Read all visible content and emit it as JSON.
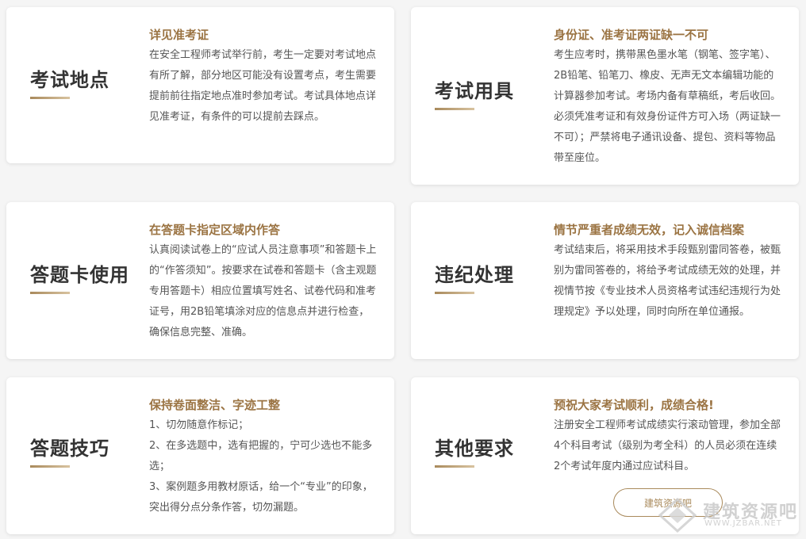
{
  "cards": [
    {
      "title": "考试地点",
      "heading": "详见准考证",
      "paragraphs": [
        "在安全工程师考试举行前，考生一定要对考试地点有所了解，部分地区可能没有设置考点，考生需要提前前往指定地点准时参加考试。考试具体地点详见准考证，有条件的可以提前去踩点。"
      ]
    },
    {
      "title": "考试用具",
      "heading": "身份证、准考证两证缺一不可",
      "paragraphs": [
        "考生应考时，携带黑色墨水笔（钢笔、签字笔）、2B铅笔、铅笔刀、橡皮、无声无文本编辑功能的计算器参加考试。考场内备有草稿纸，考后收回。必须凭准考证和有效身份证件方可入场（两证缺一不可）；严禁将电子通讯设备、提包、资料等物品带至座位。"
      ]
    },
    {
      "title": "答题卡使用",
      "heading": "在答题卡指定区域内作答",
      "paragraphs": [
        "认真阅读试卷上的“应试人员注意事项”和答题卡上的“作答须知”。按要求在试卷和答题卡（含主观题专用答题卡）相应位置填写姓名、试卷代码和准考证号，用2B铅笔填涂对应的信息点并进行检查，确保信息完整、准确。"
      ]
    },
    {
      "title": "违纪处理",
      "heading": "情节严重者成绩无效，记入诚信档案",
      "paragraphs": [
        "考试结束后，将采用技术手段甄别雷同答卷，被甄别为雷同答卷的，将给予考试成绩无效的处理，并视情节按《专业技术人员资格考试违纪违规行为处理规定》予以处理，同时向所在单位通报。"
      ]
    },
    {
      "title": "答题技巧",
      "heading": "保持卷面整洁、字迹工整",
      "paragraphs": [
        "1、切勿随意作标记；",
        "2、在多选题中，选有把握的，宁可少选也不能多选；",
        "3、案例题多用教材原话，给一个“专业”的印象，突出得分点分条作答，切勿漏题。"
      ]
    },
    {
      "title": "其他要求",
      "heading": "预祝大家考试顺利，成绩合格!",
      "paragraphs": [
        "注册安全工程师考试成绩实行滚动管理，参加全部4个科目考试（级别为考全科）的人员必须在连续2个考试年度内通过应试科目。"
      ],
      "button_label": "建筑资源吧"
    }
  ],
  "watermark": {
    "cn": "建筑资源吧",
    "en": "WWW.JZBAR.NET",
    "icon": "diamond-logo-icon"
  },
  "colors": {
    "accent": "#9b7443",
    "title": "#333333",
    "body": "#555555",
    "background": "#f5f5f5"
  }
}
